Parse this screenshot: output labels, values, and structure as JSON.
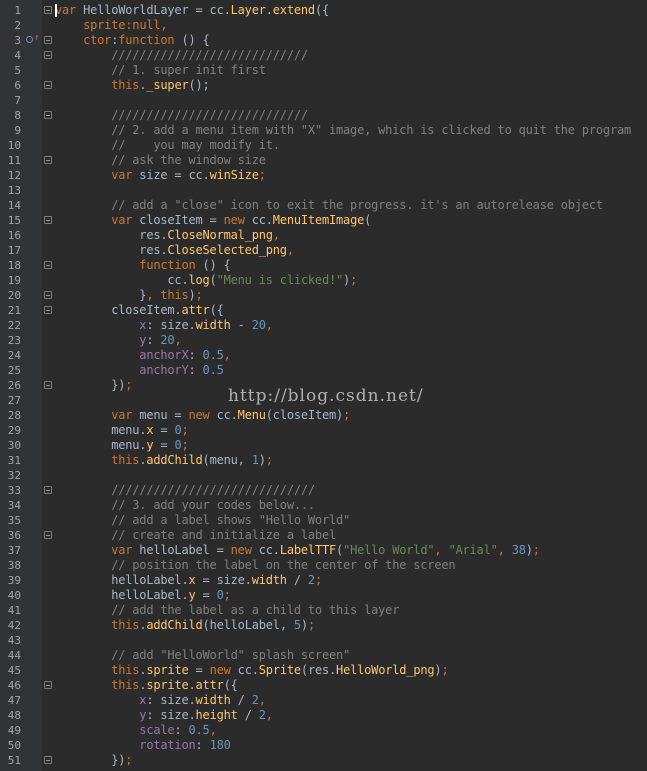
{
  "watermark": "http://blog.csdn.net/",
  "lines": [
    {
      "n": "1",
      "fold": "open",
      "override": false,
      "caret": true,
      "seg": [
        [
          "kw",
          "var"
        ],
        [
          "p",
          " HelloWorldLayer = cc."
        ],
        [
          "fld",
          "Layer"
        ],
        [
          "p",
          "."
        ],
        [
          "fld",
          "extend"
        ],
        [
          "p",
          "({"
        ]
      ]
    },
    {
      "n": "2",
      "fold": "",
      "override": false,
      "seg": [
        [
          "p",
          "    "
        ],
        [
          "kw",
          "sprite"
        ],
        [
          "kw",
          ":"
        ],
        [
          "kw",
          "null"
        ],
        [
          "kw",
          ","
        ]
      ]
    },
    {
      "n": "3",
      "fold": "open",
      "override": true,
      "seg": [
        [
          "p",
          "    "
        ],
        [
          "kw",
          "ctor"
        ],
        [
          "p",
          ":"
        ],
        [
          "kw",
          "function"
        ],
        [
          "p",
          " () {"
        ]
      ]
    },
    {
      "n": "4",
      "fold": "open",
      "override": false,
      "seg": [
        [
          "p",
          "        "
        ],
        [
          "com",
          "////////////////////////////"
        ]
      ]
    },
    {
      "n": "5",
      "fold": "",
      "override": false,
      "seg": [
        [
          "p",
          "        "
        ],
        [
          "com",
          "// 1. super init first"
        ]
      ]
    },
    {
      "n": "6",
      "fold": "close",
      "override": false,
      "seg": [
        [
          "p",
          "        "
        ],
        [
          "kw",
          "this"
        ],
        [
          "p",
          "."
        ],
        [
          "fld",
          "_super"
        ],
        [
          "p",
          "();"
        ]
      ]
    },
    {
      "n": "7",
      "fold": "",
      "override": false,
      "seg": []
    },
    {
      "n": "8",
      "fold": "open",
      "override": false,
      "seg": [
        [
          "p",
          "        "
        ],
        [
          "com",
          "////////////////////////////"
        ]
      ]
    },
    {
      "n": "9",
      "fold": "",
      "override": false,
      "seg": [
        [
          "p",
          "        "
        ],
        [
          "com",
          "// 2. add a menu item with \"X\" image, which is clicked to quit the program"
        ]
      ]
    },
    {
      "n": "10",
      "fold": "",
      "override": false,
      "seg": [
        [
          "p",
          "        "
        ],
        [
          "com",
          "//    you may modify it."
        ]
      ]
    },
    {
      "n": "11",
      "fold": "close",
      "override": false,
      "seg": [
        [
          "p",
          "        "
        ],
        [
          "com",
          "// ask the window size"
        ]
      ]
    },
    {
      "n": "12",
      "fold": "",
      "override": false,
      "seg": [
        [
          "p",
          "        "
        ],
        [
          "kw",
          "var"
        ],
        [
          "p",
          " size = cc."
        ],
        [
          "fld",
          "winSize"
        ],
        [
          "kw",
          ";"
        ]
      ]
    },
    {
      "n": "13",
      "fold": "",
      "override": false,
      "seg": []
    },
    {
      "n": "14",
      "fold": "",
      "override": false,
      "seg": [
        [
          "p",
          "        "
        ],
        [
          "com",
          "// add a \"close\" icon to exit the progress. it's an autorelease object"
        ]
      ]
    },
    {
      "n": "15",
      "fold": "open",
      "override": false,
      "seg": [
        [
          "p",
          "        "
        ],
        [
          "kw",
          "var"
        ],
        [
          "p",
          " closeItem = "
        ],
        [
          "kw",
          "new"
        ],
        [
          "p",
          " cc."
        ],
        [
          "fld",
          "MenuItemImage"
        ],
        [
          "p",
          "("
        ]
      ]
    },
    {
      "n": "16",
      "fold": "",
      "override": false,
      "seg": [
        [
          "p",
          "            res."
        ],
        [
          "fld",
          "CloseNormal_png"
        ],
        [
          "kw",
          ","
        ]
      ]
    },
    {
      "n": "17",
      "fold": "",
      "override": false,
      "seg": [
        [
          "p",
          "            res."
        ],
        [
          "fld",
          "CloseSelected_png"
        ],
        [
          "kw",
          ","
        ]
      ]
    },
    {
      "n": "18",
      "fold": "open",
      "override": false,
      "seg": [
        [
          "p",
          "            "
        ],
        [
          "kw",
          "function"
        ],
        [
          "p",
          " () {"
        ]
      ]
    },
    {
      "n": "19",
      "fold": "",
      "override": false,
      "seg": [
        [
          "p",
          "                cc."
        ],
        [
          "fld",
          "log"
        ],
        [
          "p",
          "("
        ],
        [
          "str",
          "\"Menu is clicked!\""
        ],
        [
          "p",
          ")"
        ],
        [
          "kw",
          ";"
        ]
      ]
    },
    {
      "n": "20",
      "fold": "close",
      "override": false,
      "seg": [
        [
          "p",
          "            }"
        ],
        [
          "kw",
          ","
        ],
        [
          "p",
          " "
        ],
        [
          "kw",
          "this"
        ],
        [
          "p",
          ")"
        ],
        [
          "kw",
          ";"
        ]
      ]
    },
    {
      "n": "21",
      "fold": "open",
      "override": false,
      "seg": [
        [
          "p",
          "        closeItem."
        ],
        [
          "fld",
          "attr"
        ],
        [
          "p",
          "({"
        ]
      ]
    },
    {
      "n": "22",
      "fold": "",
      "override": false,
      "seg": [
        [
          "p",
          "            "
        ],
        [
          "prop",
          "x"
        ],
        [
          "p",
          ": size."
        ],
        [
          "fld",
          "width"
        ],
        [
          "p",
          " - "
        ],
        [
          "num",
          "20"
        ],
        [
          "kw",
          ","
        ]
      ]
    },
    {
      "n": "23",
      "fold": "",
      "override": false,
      "seg": [
        [
          "p",
          "            "
        ],
        [
          "prop",
          "y"
        ],
        [
          "p",
          ": "
        ],
        [
          "num",
          "20"
        ],
        [
          "kw",
          ","
        ]
      ]
    },
    {
      "n": "24",
      "fold": "",
      "override": false,
      "seg": [
        [
          "p",
          "            "
        ],
        [
          "prop",
          "anchorX"
        ],
        [
          "p",
          ": "
        ],
        [
          "num",
          "0.5"
        ],
        [
          "kw",
          ","
        ]
      ]
    },
    {
      "n": "25",
      "fold": "",
      "override": false,
      "seg": [
        [
          "p",
          "            "
        ],
        [
          "prop",
          "anchorY"
        ],
        [
          "p",
          ": "
        ],
        [
          "num",
          "0.5"
        ]
      ]
    },
    {
      "n": "26",
      "fold": "close",
      "override": false,
      "seg": [
        [
          "p",
          "        })"
        ],
        [
          "kw",
          ";"
        ]
      ]
    },
    {
      "n": "27",
      "fold": "",
      "override": false,
      "seg": []
    },
    {
      "n": "28",
      "fold": "",
      "override": false,
      "seg": [
        [
          "p",
          "        "
        ],
        [
          "kw",
          "var"
        ],
        [
          "p",
          " menu = "
        ],
        [
          "kw",
          "new"
        ],
        [
          "p",
          " cc."
        ],
        [
          "fld",
          "Menu"
        ],
        [
          "p",
          "(closeItem)"
        ],
        [
          "kw",
          ";"
        ]
      ]
    },
    {
      "n": "29",
      "fold": "",
      "override": false,
      "seg": [
        [
          "p",
          "        menu."
        ],
        [
          "fld",
          "x"
        ],
        [
          "p",
          " = "
        ],
        [
          "num",
          "0"
        ],
        [
          "kw",
          ";"
        ]
      ]
    },
    {
      "n": "30",
      "fold": "",
      "override": false,
      "seg": [
        [
          "p",
          "        menu."
        ],
        [
          "fld",
          "y"
        ],
        [
          "p",
          " = "
        ],
        [
          "num",
          "0"
        ],
        [
          "kw",
          ";"
        ]
      ]
    },
    {
      "n": "31",
      "fold": "",
      "override": false,
      "seg": [
        [
          "p",
          "        "
        ],
        [
          "kw",
          "this"
        ],
        [
          "p",
          "."
        ],
        [
          "fld",
          "addChild"
        ],
        [
          "p",
          "(menu, "
        ],
        [
          "num",
          "1"
        ],
        [
          "p",
          ")"
        ],
        [
          "kw",
          ";"
        ]
      ]
    },
    {
      "n": "32",
      "fold": "",
      "override": false,
      "seg": []
    },
    {
      "n": "33",
      "fold": "open",
      "override": false,
      "seg": [
        [
          "p",
          "        "
        ],
        [
          "com",
          "/////////////////////////////"
        ]
      ]
    },
    {
      "n": "34",
      "fold": "",
      "override": false,
      "seg": [
        [
          "p",
          "        "
        ],
        [
          "com",
          "// 3. add your codes below..."
        ]
      ]
    },
    {
      "n": "35",
      "fold": "",
      "override": false,
      "seg": [
        [
          "p",
          "        "
        ],
        [
          "com",
          "// add a label shows \"Hello World\""
        ]
      ]
    },
    {
      "n": "36",
      "fold": "close",
      "override": false,
      "seg": [
        [
          "p",
          "        "
        ],
        [
          "com",
          "// create and initialize a label"
        ]
      ]
    },
    {
      "n": "37",
      "fold": "",
      "override": false,
      "seg": [
        [
          "p",
          "        "
        ],
        [
          "kw",
          "var"
        ],
        [
          "p",
          " helloLabel = "
        ],
        [
          "kw",
          "new"
        ],
        [
          "p",
          " cc."
        ],
        [
          "fld",
          "LabelTTF"
        ],
        [
          "p",
          "("
        ],
        [
          "str",
          "\"Hello World\""
        ],
        [
          "kw",
          ","
        ],
        [
          "p",
          " "
        ],
        [
          "str",
          "\"Arial\""
        ],
        [
          "kw",
          ","
        ],
        [
          "p",
          " "
        ],
        [
          "num",
          "38"
        ],
        [
          "p",
          ")"
        ],
        [
          "kw",
          ";"
        ]
      ]
    },
    {
      "n": "38",
      "fold": "",
      "override": false,
      "seg": [
        [
          "p",
          "        "
        ],
        [
          "com",
          "// position the label on the center of the screen"
        ]
      ]
    },
    {
      "n": "39",
      "fold": "",
      "override": false,
      "seg": [
        [
          "p",
          "        helloLabel."
        ],
        [
          "fld",
          "x"
        ],
        [
          "p",
          " = size."
        ],
        [
          "fld",
          "width"
        ],
        [
          "p",
          " / "
        ],
        [
          "num",
          "2"
        ],
        [
          "kw",
          ";"
        ]
      ]
    },
    {
      "n": "40",
      "fold": "",
      "override": false,
      "seg": [
        [
          "p",
          "        helloLabel."
        ],
        [
          "fld",
          "y"
        ],
        [
          "p",
          " = "
        ],
        [
          "num",
          "0"
        ],
        [
          "kw",
          ";"
        ]
      ]
    },
    {
      "n": "41",
      "fold": "",
      "override": false,
      "seg": [
        [
          "p",
          "        "
        ],
        [
          "com",
          "// add the label as a child to this layer"
        ]
      ]
    },
    {
      "n": "42",
      "fold": "",
      "override": false,
      "seg": [
        [
          "p",
          "        "
        ],
        [
          "kw",
          "this"
        ],
        [
          "p",
          "."
        ],
        [
          "fld",
          "addChild"
        ],
        [
          "p",
          "(helloLabel, "
        ],
        [
          "num",
          "5"
        ],
        [
          "p",
          ")"
        ],
        [
          "kw",
          ";"
        ]
      ]
    },
    {
      "n": "43",
      "fold": "",
      "override": false,
      "seg": []
    },
    {
      "n": "44",
      "fold": "",
      "override": false,
      "seg": [
        [
          "p",
          "        "
        ],
        [
          "com",
          "// add \"HelloWorld\" splash screen\""
        ]
      ]
    },
    {
      "n": "45",
      "fold": "",
      "override": false,
      "seg": [
        [
          "p",
          "        "
        ],
        [
          "kw",
          "this"
        ],
        [
          "p",
          "."
        ],
        [
          "fld",
          "sprite"
        ],
        [
          "p",
          " = "
        ],
        [
          "kw",
          "new"
        ],
        [
          "p",
          " cc."
        ],
        [
          "fld",
          "Sprite"
        ],
        [
          "p",
          "(res."
        ],
        [
          "fld",
          "HelloWorld_png"
        ],
        [
          "p",
          ")"
        ],
        [
          "kw",
          ";"
        ]
      ]
    },
    {
      "n": "46",
      "fold": "open",
      "override": false,
      "seg": [
        [
          "p",
          "        "
        ],
        [
          "kw",
          "this"
        ],
        [
          "p",
          "."
        ],
        [
          "fld",
          "sprite"
        ],
        [
          "p",
          "."
        ],
        [
          "fld",
          "attr"
        ],
        [
          "p",
          "({"
        ]
      ]
    },
    {
      "n": "47",
      "fold": "",
      "override": false,
      "seg": [
        [
          "p",
          "            "
        ],
        [
          "prop",
          "x"
        ],
        [
          "p",
          ": size."
        ],
        [
          "fld",
          "width"
        ],
        [
          "p",
          " / "
        ],
        [
          "num",
          "2"
        ],
        [
          "kw",
          ","
        ]
      ]
    },
    {
      "n": "48",
      "fold": "",
      "override": false,
      "seg": [
        [
          "p",
          "            "
        ],
        [
          "prop",
          "y"
        ],
        [
          "p",
          ": size."
        ],
        [
          "fld",
          "height"
        ],
        [
          "p",
          " / "
        ],
        [
          "num",
          "2"
        ],
        [
          "kw",
          ","
        ]
      ]
    },
    {
      "n": "49",
      "fold": "",
      "override": false,
      "seg": [
        [
          "p",
          "            "
        ],
        [
          "prop",
          "scale"
        ],
        [
          "p",
          ": "
        ],
        [
          "num",
          "0.5"
        ],
        [
          "kw",
          ","
        ]
      ]
    },
    {
      "n": "50",
      "fold": "",
      "override": false,
      "seg": [
        [
          "p",
          "            "
        ],
        [
          "prop",
          "rotation"
        ],
        [
          "p",
          ": "
        ],
        [
          "num",
          "180"
        ]
      ]
    },
    {
      "n": "51",
      "fold": "close",
      "override": false,
      "seg": [
        [
          "p",
          "        })"
        ],
        [
          "kw",
          ";"
        ]
      ]
    }
  ]
}
